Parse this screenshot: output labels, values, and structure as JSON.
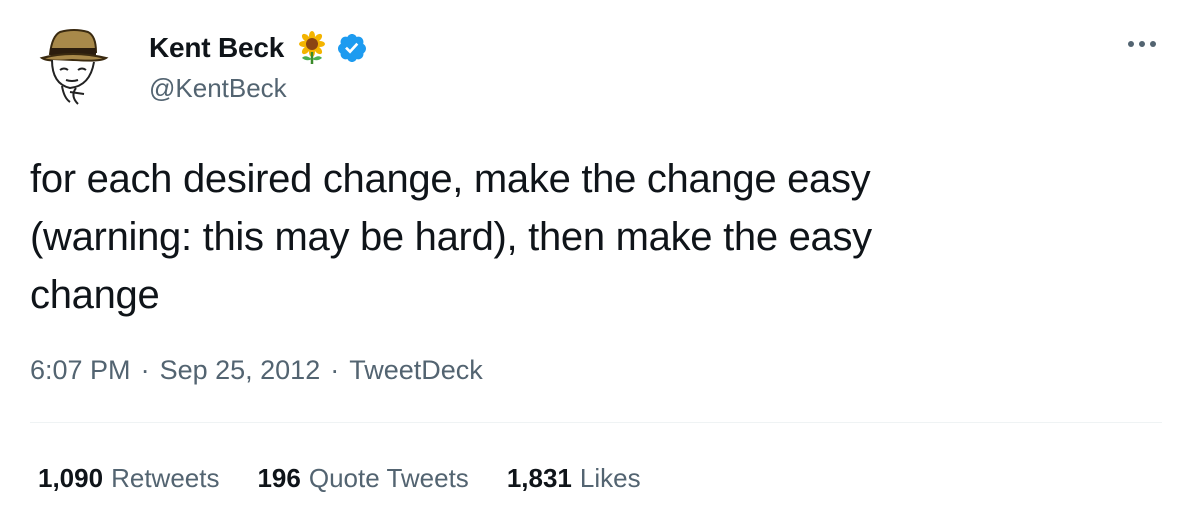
{
  "author": {
    "display_name": "Kent Beck",
    "handle": "@KentBeck",
    "badge_emoji": "sunflower-icon",
    "verified_icon": "verified-badge-icon",
    "verified_color": "#1d9bf0"
  },
  "tweet": {
    "text": "for each desired change, make the change easy\n(warning: this may be hard), then make the easy\nchange"
  },
  "meta": {
    "time": "6:07 PM",
    "date": "Sep 25, 2012",
    "source": "TweetDeck",
    "separator": "·"
  },
  "stats": {
    "retweets_count": "1,090",
    "retweets_label": "Retweets",
    "quotes_count": "196",
    "quotes_label": "Quote Tweets",
    "likes_count": "1,831",
    "likes_label": "Likes"
  },
  "more_icon": "more-horizontal-icon"
}
